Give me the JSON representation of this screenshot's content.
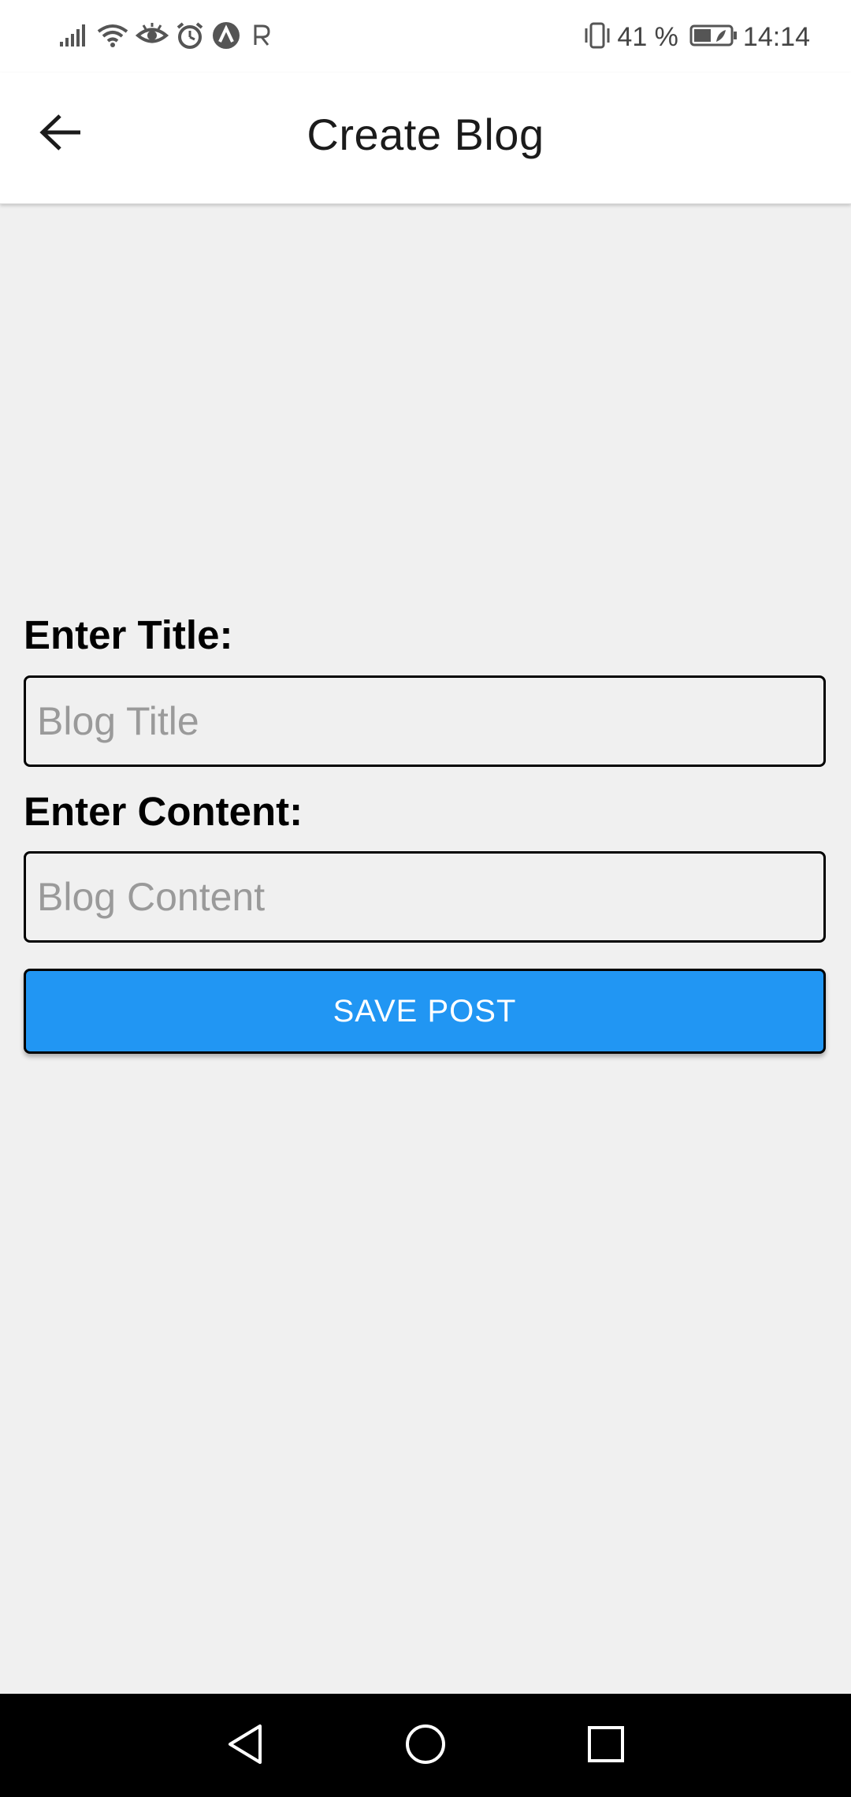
{
  "status_bar": {
    "battery_text": "41 %",
    "time": "14:14",
    "icons": [
      "signal-icon",
      "wifi-icon",
      "eye-icon",
      "alarm-icon",
      "app-a-icon",
      "app-r-icon",
      "vibrate-icon",
      "battery-icon"
    ]
  },
  "header": {
    "title": "Create Blog",
    "back_icon": "arrow-left-icon"
  },
  "form": {
    "title_label": "Enter Title:",
    "title_placeholder": "Blog Title",
    "title_value": "",
    "content_label": "Enter Content:",
    "content_placeholder": "Blog Content",
    "content_value": "",
    "save_label": "SAVE POST",
    "save_color": "#2196f3"
  },
  "nav_bar": {
    "icons": [
      "nav-back-icon",
      "nav-home-icon",
      "nav-recents-icon"
    ]
  }
}
